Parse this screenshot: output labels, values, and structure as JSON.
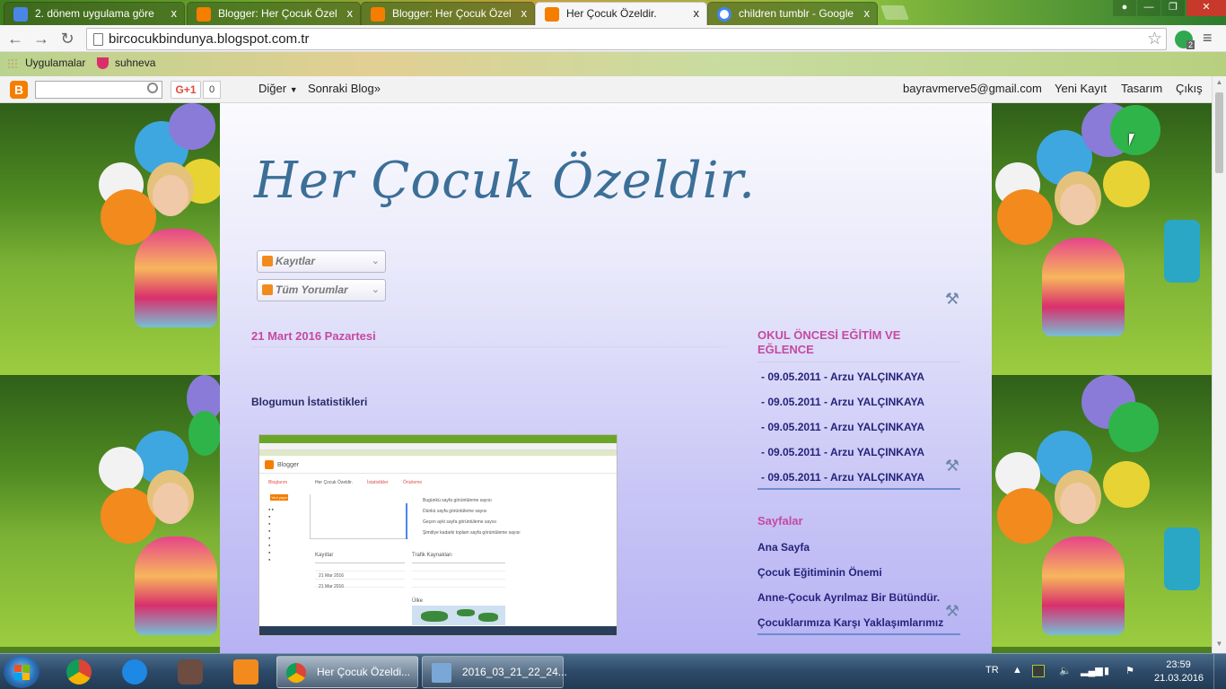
{
  "browser": {
    "tabs": [
      {
        "title": "2. dönem uygulama göre",
        "icon": "docs-icon"
      },
      {
        "title": "Blogger: Her Çocuk Özel",
        "icon": "blogger-icon"
      },
      {
        "title": "Blogger: Her Çocuk Özel",
        "icon": "blogger-icon"
      },
      {
        "title": "Her Çocuk Özeldir.",
        "icon": "blogger-icon",
        "active": true
      },
      {
        "title": "children tumblr - Google",
        "icon": "google-icon"
      }
    ],
    "tab_close_glyph": "x",
    "url": "bircocukbindunya.blogspot.com.tr",
    "extension_badge": "2",
    "bookmarks": {
      "apps_label": "Uygulamalar",
      "items": [
        "suhneva"
      ]
    }
  },
  "blogger_navbar": {
    "search_value": "",
    "gplus_label": "G+1",
    "gplus_count": "0",
    "more_label": "Diğer",
    "next_blog_label": "Sonraki Blog»",
    "account_email": "bayravmerve5@gmail.com",
    "new_post_label": "Yeni Kayıt",
    "design_label": "Tasarım",
    "signout_label": "Çıkış"
  },
  "blog": {
    "title": "Her Çocuk Özeldir.",
    "feeds": [
      "Kayıtlar",
      "Tüm Yorumlar"
    ],
    "post": {
      "date": "21 Mart 2016 Pazartesi",
      "title": "Blogumun İstatistikleri",
      "screenshot": {
        "blogger_label": "Blogger",
        "blog_name": "Her Çocuk Özeldir.",
        "breadcrumb": "Bloglarım",
        "stats_label": "İstatistikler",
        "overview_label": "Önizleme",
        "new_post_btn": "Yeni yayın",
        "stat_lines": [
          "Bugünkü sayfa görüntüleme sayısı",
          "Dünkü sayfa görüntüleme sayısı",
          "Geçen ayki sayfa görüntüleme sayısı",
          "Şimdiye kadarki toplam sayfa görüntüleme sayısı"
        ],
        "posts_header": "Kayıtlar",
        "traffic_header": "Trafik Kaynakları",
        "map_header": "Ülke",
        "row_dates": [
          "21 Mar 2016",
          "21 Mar 2016"
        ]
      }
    },
    "sidebar": {
      "sections": [
        {
          "title": "OKUL ÖNCESİ EĞİTİM VE EĞLENCE",
          "items": [
            "- 09.05.2011 - Arzu YALÇINKAYA",
            "- 09.05.2011 - Arzu YALÇINKAYA",
            "- 09.05.2011 - Arzu YALÇINKAYA",
            "- 09.05.2011 - Arzu YALÇINKAYA",
            "- 09.05.2011 - Arzu YALÇINKAYA"
          ]
        },
        {
          "title": "Sayfalar",
          "items": [
            "Ana Sayfa",
            "Çocuk Eğitiminin Önemi",
            "Anne-Çocuk Ayrılmaz Bir Bütündür.",
            "Çocuklarımıza Karşı Yaklaşımlarımız"
          ]
        }
      ]
    }
  },
  "taskbar": {
    "windows": [
      {
        "label": "Her Çocuk Özeldi...",
        "icon": "chrome-icon",
        "active": true
      },
      {
        "label": "2016_03_21_22_24...",
        "icon": "image-icon"
      }
    ],
    "language": "TR",
    "time": "23:59",
    "date": "21.03.2016"
  },
  "colors": {
    "blog_title": "#3c6f97",
    "accent_pink": "#c44aa0",
    "link_navy": "#25237a",
    "blogger_orange": "#f57d00"
  }
}
